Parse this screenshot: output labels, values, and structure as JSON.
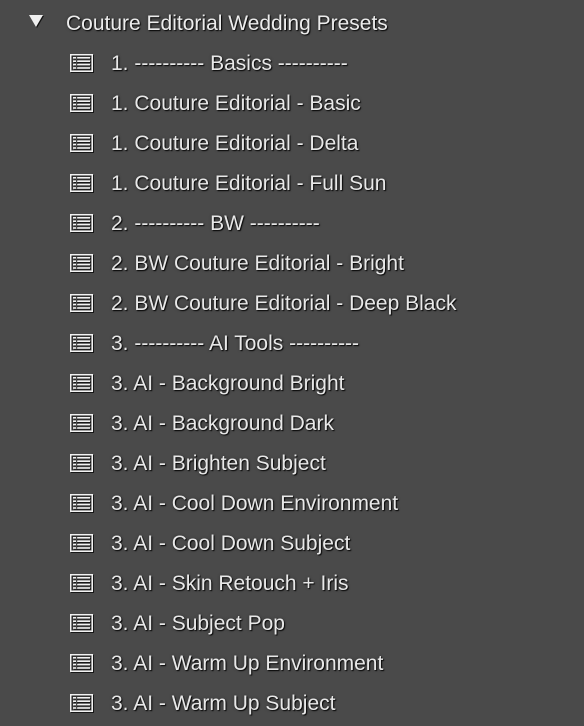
{
  "colors": {
    "panel_background": "#4a4a4a",
    "text": "#e8e8e8",
    "icon": "#f2f2f2"
  },
  "folder": {
    "title": "Couture Editorial Wedding Presets",
    "expanded_icon": "disclosure-triangle-expanded-icon"
  },
  "presets": [
    {
      "label": "1. ---------- Basics ----------",
      "icon": "preset-icon"
    },
    {
      "label": "1. Couture Editorial - Basic",
      "icon": "preset-icon"
    },
    {
      "label": "1. Couture Editorial - Delta",
      "icon": "preset-icon"
    },
    {
      "label": "1. Couture Editorial - Full Sun",
      "icon": "preset-icon"
    },
    {
      "label": "2. ---------- BW ----------",
      "icon": "preset-icon"
    },
    {
      "label": "2. BW Couture Editorial - Bright",
      "icon": "preset-icon"
    },
    {
      "label": "2. BW Couture Editorial - Deep Black",
      "icon": "preset-icon"
    },
    {
      "label": "3. ---------- AI Tools ----------",
      "icon": "preset-icon"
    },
    {
      "label": "3. AI - Background Bright",
      "icon": "preset-icon"
    },
    {
      "label": "3. AI - Background Dark",
      "icon": "preset-icon"
    },
    {
      "label": "3. AI - Brighten Subject",
      "icon": "preset-icon"
    },
    {
      "label": "3. AI - Cool Down Environment",
      "icon": "preset-icon"
    },
    {
      "label": "3. AI - Cool Down Subject",
      "icon": "preset-icon"
    },
    {
      "label": "3. AI - Skin Retouch + Iris",
      "icon": "preset-icon"
    },
    {
      "label": "3. AI - Subject Pop",
      "icon": "preset-icon"
    },
    {
      "label": "3. AI - Warm Up Environment",
      "icon": "preset-icon"
    },
    {
      "label": "3. AI - Warm Up Subject",
      "icon": "preset-icon"
    }
  ]
}
